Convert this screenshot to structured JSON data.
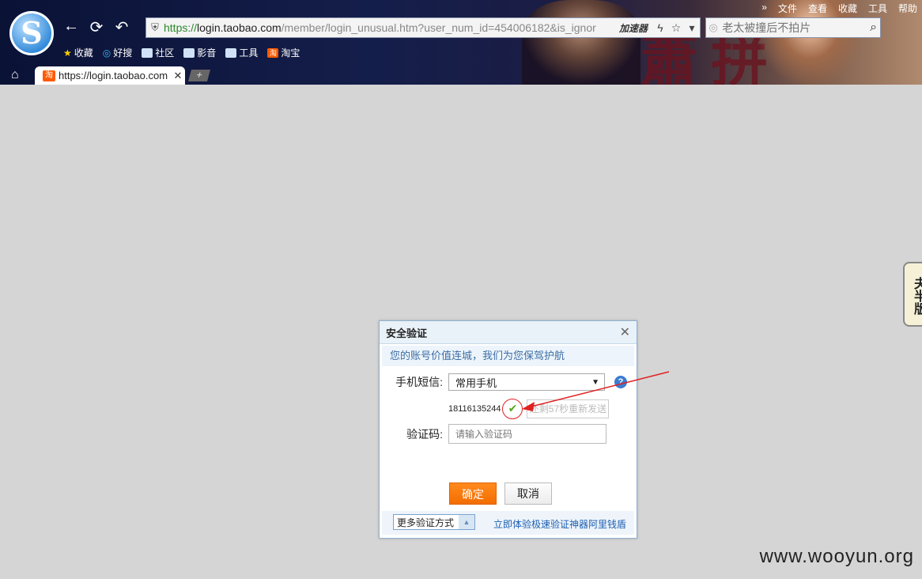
{
  "browser": {
    "menu": [
      "»",
      "文件",
      "查看",
      "收藏",
      "工具",
      "帮助"
    ],
    "address": {
      "scheme": "https://",
      "host": "login.taobao.com",
      "path": "/member/login_unusual.htm?user_num_id=454006182&is_ignor",
      "accelerator": "加速器"
    },
    "search_placeholder": "老太被撞后不拍片",
    "bookmarks": [
      "收藏",
      "好搜",
      "社区",
      "影音",
      "工具",
      "淘宝"
    ],
    "tab": {
      "favicon": "淘",
      "title": "https://login.taobao.com",
      "close": "✕"
    },
    "newtab": "+"
  },
  "colors": {
    "accent": "#ff7a00",
    "link": "#1c5fb1",
    "annotation": "#e02020"
  },
  "dialog": {
    "title": "安全验证",
    "close": "✕",
    "tip": "您的账号价值连城，我们为您保驾护航",
    "sms_label": "手机短信:",
    "phone_select": "常用手机",
    "phone_number": "18116135244",
    "resend_label": "还剩57秒重新发送",
    "code_label": "验证码:",
    "code_placeholder": "请输入验证码",
    "confirm": "确定",
    "cancel": "取消",
    "more_methods": "更多验证方式",
    "promo_link": "立即体验极速验证神器阿里钱盾"
  },
  "side_flag": "夫半版",
  "watermark": "www.wooyun.org"
}
